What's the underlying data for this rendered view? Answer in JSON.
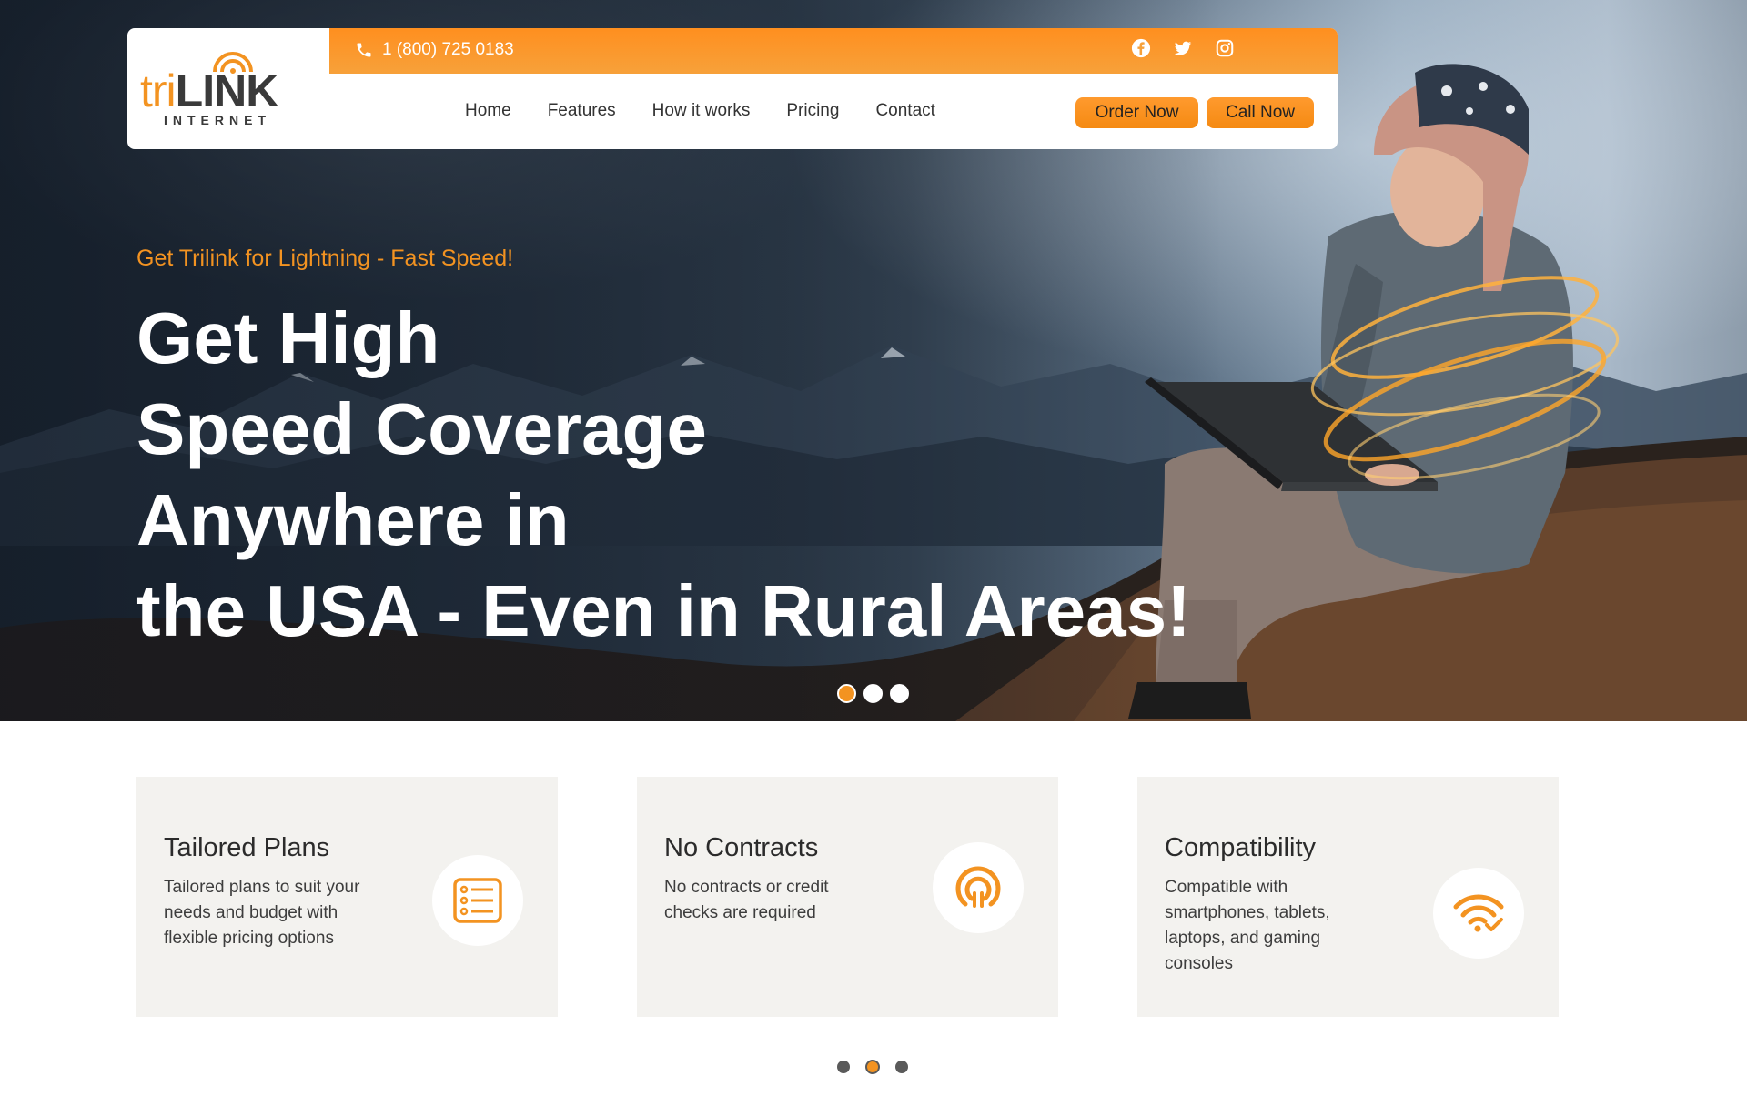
{
  "brand": {
    "logo_tri": "tri",
    "logo_link": "LINK",
    "logo_sub": "INTERNET",
    "accent_color": "#f39321"
  },
  "topbar": {
    "phone": "1 (800) 725 0183",
    "phone_icon": "phone-icon",
    "socials": [
      "facebook-icon",
      "twitter-icon",
      "instagram-icon"
    ]
  },
  "nav": {
    "items": [
      {
        "label": "Home"
      },
      {
        "label": "Features"
      },
      {
        "label": "How it works"
      },
      {
        "label": "Pricing"
      },
      {
        "label": "Contact"
      }
    ],
    "order_label": "Order Now",
    "call_label": "Call Now"
  },
  "hero": {
    "tagline": "Get Trilink for Lightning - Fast Speed!",
    "headline": [
      "Get High",
      "Speed Coverage",
      "Anywhere in",
      "the USA - Even in Rural Areas!"
    ],
    "slides": 3,
    "active_slide": 1
  },
  "features": {
    "cards": [
      {
        "title": "Tailored Plans",
        "text": "Tailored plans to suit your needs and budget with flexible pricing options",
        "icon": "list-icon"
      },
      {
        "title": "No Contracts",
        "text": "No contracts or credit checks are required",
        "icon": "signal-icon"
      },
      {
        "title": "Compatibility",
        "text": "Compatible with smartphones, tablets, laptops, and gaming consoles",
        "icon": "wifi-check-icon"
      }
    ],
    "pages": 3,
    "active_page": 2
  }
}
